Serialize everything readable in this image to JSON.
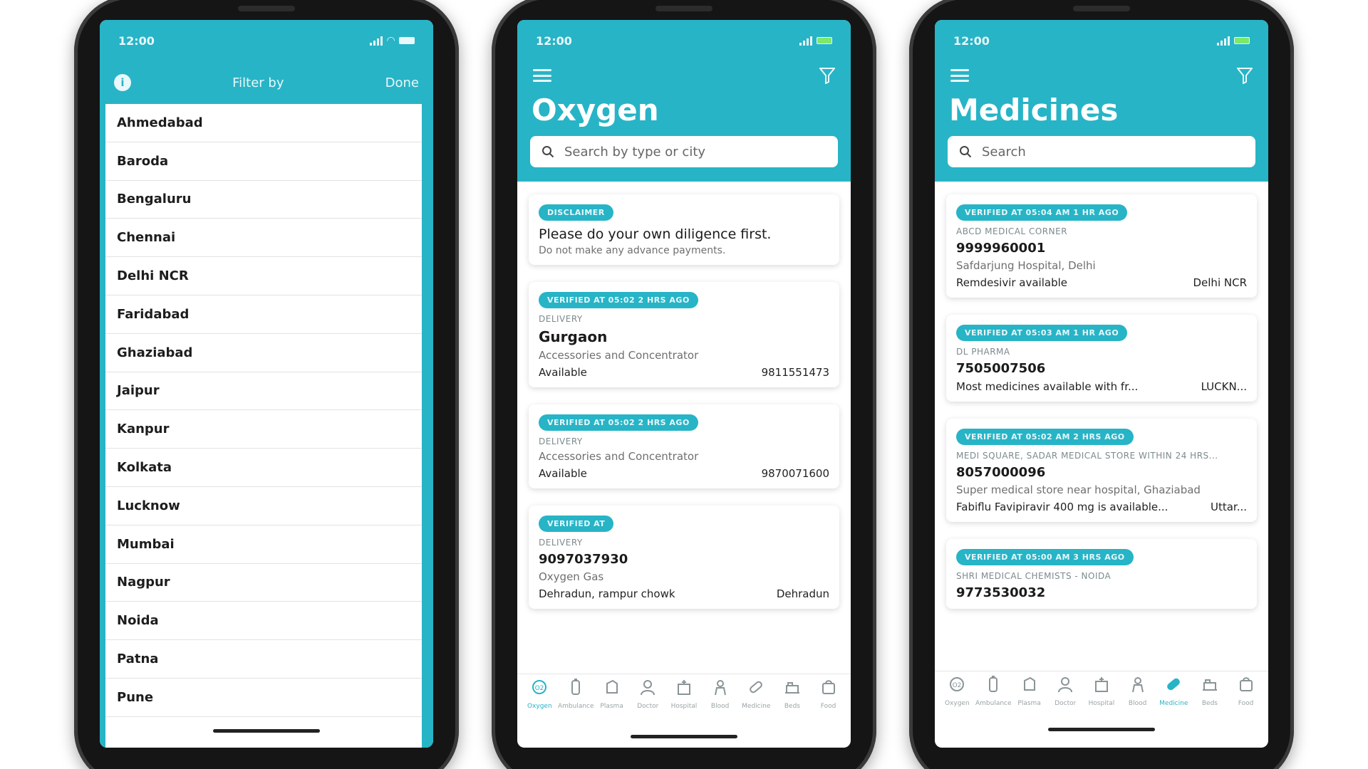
{
  "colors": {
    "accent": "#27b4c6",
    "phone_frame": "#151515"
  },
  "phone1": {
    "status_time": "12:00",
    "filter_title": "Filter by",
    "done_label": "Done",
    "info_icon": "info-icon",
    "cities": [
      "Ahmedabad",
      "Baroda",
      "Bengaluru",
      "Chennai",
      "Delhi NCR",
      "Faridabad",
      "Ghaziabad",
      "Jaipur",
      "Kanpur",
      "Kolkata",
      "Lucknow",
      "Mumbai",
      "Nagpur",
      "Noida",
      "Patna",
      "Pune"
    ]
  },
  "phone2": {
    "status_time": "12:00",
    "title": "Oxygen",
    "search_placeholder": "Search by type or city",
    "cards": [
      {
        "badge": "DISCLAIMER",
        "title": "Please do your own diligence first.",
        "desc": "Do not make any advance payments."
      },
      {
        "badge": "VERIFIED AT 05:02 2 HRS AGO",
        "sub": "DELIVERY",
        "title": "Gurgaon",
        "desc": "Accessories and Concentrator",
        "left": "Available",
        "right": "9811551473"
      },
      {
        "badge": "VERIFIED AT 05:02 2 HRS AGO",
        "sub": "DELIVERY",
        "desc": "Accessories and Concentrator",
        "left": "Available",
        "right": "9870071600"
      },
      {
        "badge": "VERIFIED AT",
        "sub": "DELIVERY",
        "phone": "9097037930",
        "desc": "Oxygen Gas",
        "left": "Dehradun, rampur chowk",
        "right": "Dehradun"
      }
    ],
    "tabs": [
      "Oxygen",
      "Ambulance",
      "Plasma",
      "Doctor",
      "Hospital",
      "Blood",
      "Medicine",
      "Beds",
      "Food"
    ],
    "active_tab": 0
  },
  "phone3": {
    "status_time": "12:00",
    "title": "Medicines",
    "search_placeholder": "Search",
    "cards": [
      {
        "badge": "VERIFIED AT 05:04 AM 1 HR AGO",
        "sub": "ABCD MEDICAL CORNER",
        "phone": "9999960001",
        "desc": "Safdarjung Hospital, Delhi",
        "left": "Remdesivir available",
        "right": "Delhi NCR"
      },
      {
        "badge": "VERIFIED AT 05:03 AM 1 HR AGO",
        "sub": "DL PHARMA",
        "phone": "7505007506",
        "left": "Most medicines available with fr...",
        "right": "LUCKN..."
      },
      {
        "badge": "VERIFIED AT 05:02 AM 2 HRS AGO",
        "sub": "MEDI SQUARE, SADAR MEDICAL STORE WITHIN 24 HRS...",
        "phone": "8057000096",
        "desc": "Super medical store near hospital, Ghaziabad",
        "left": "Fabiflu Favipiravir 400 mg is available...",
        "right": "Uttar..."
      },
      {
        "badge": "VERIFIED AT 05:00 AM 3 HRS AGO",
        "sub": "SHRI MEDICAL CHEMISTS - NOIDA",
        "phone": "9773530032"
      }
    ],
    "tabs": [
      "Oxygen",
      "Ambulance",
      "Plasma",
      "Doctor",
      "Hospital",
      "Blood",
      "Medicine",
      "Beds",
      "Food"
    ],
    "active_tab": 6
  }
}
